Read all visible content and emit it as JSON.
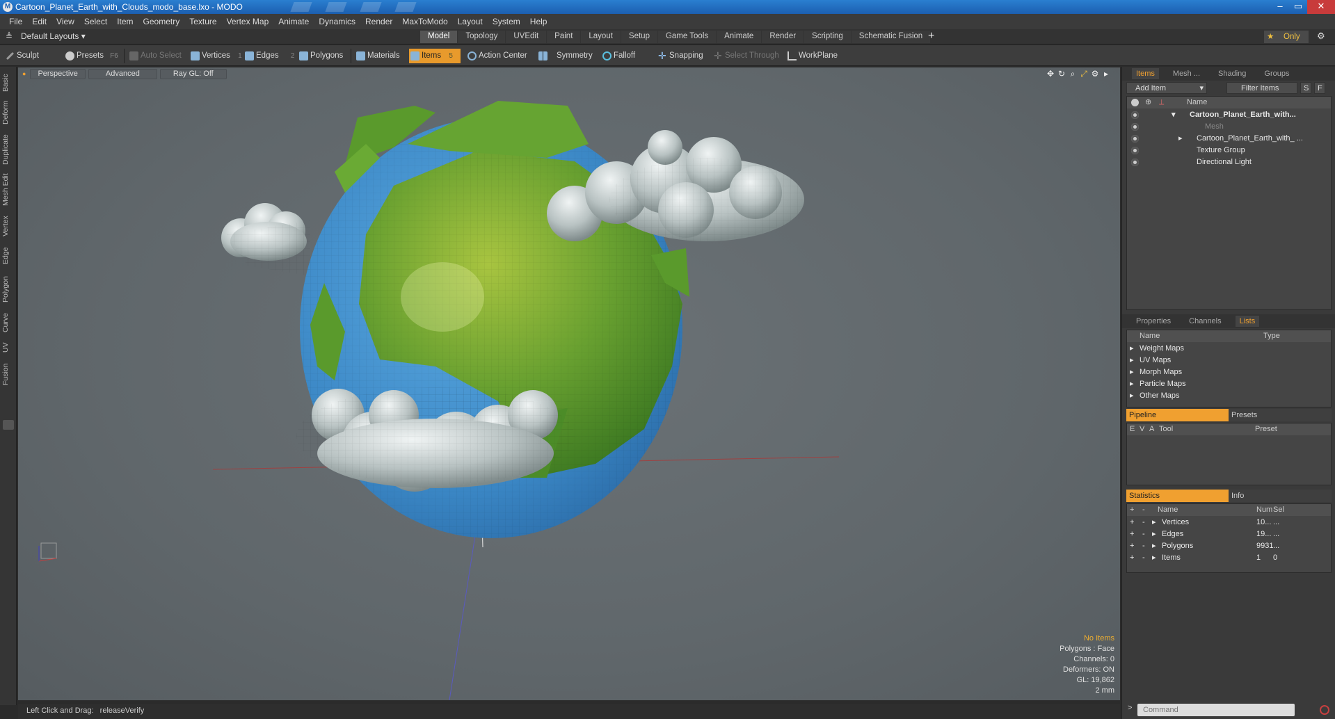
{
  "window": {
    "title": "Cartoon_Planet_Earth_with_Clouds_modo_base.lxo - MODO",
    "app_icon": "modo-logo-icon",
    "controls": [
      "–",
      "▭",
      "✕"
    ]
  },
  "menu": [
    "File",
    "Edit",
    "View",
    "Select",
    "Item",
    "Geometry",
    "Texture",
    "Vertex Map",
    "Animate",
    "Dynamics",
    "Render",
    "MaxToModo",
    "Layout",
    "System",
    "Help"
  ],
  "layoutbar": {
    "layout_select": "Default Layouts ▾",
    "tabs": [
      "Model",
      "Topology",
      "UVEdit",
      "Paint",
      "Layout",
      "Setup",
      "Game Tools",
      "Animate",
      "Render",
      "Scripting",
      "Schematic Fusion"
    ],
    "active_tab": "Model",
    "only_label": "Only"
  },
  "toolbar": {
    "sculpt": "Sculpt",
    "presets": "Presets",
    "presets_key": "F6",
    "auto_select": "Auto Select",
    "vertices": "Vertices",
    "vertices_count": "1",
    "edges": "Edges",
    "edges_count": "2",
    "polygons": "Polygons",
    "materials": "Materials",
    "items": "Items",
    "items_count": "5",
    "action_center": "Action Center",
    "symmetry": "Symmetry",
    "falloff": "Falloff",
    "snapping": "Snapping",
    "select_through": "Select Through",
    "workplane": "WorkPlane"
  },
  "left_tabs": [
    "Basic",
    "Deform",
    "Duplicate",
    "Mesh Edit",
    "Vertex",
    "Edge",
    "Polygon",
    "Curve",
    "UV",
    "Fusion"
  ],
  "viewport": {
    "view_mode": "Perspective",
    "shading": "Advanced",
    "raygl": "Ray GL: Off",
    "stats": {
      "no_items": "No Items",
      "polygons": "Polygons : Face",
      "channels": "Channels: 0",
      "deformers": "Deformers: ON",
      "gl": "GL: 19,862",
      "scale": "2 mm"
    }
  },
  "status": {
    "hint": "Left Click and Drag:",
    "action": "releaseVerify"
  },
  "items_panel": {
    "tabs": [
      "Items",
      "Mesh ...",
      "Shading",
      "Groups"
    ],
    "active_tab": "Items",
    "add_item": "Add Item",
    "filter_items": "Filter Items",
    "s_btn": "S",
    "f_btn": "F",
    "column_name": "Name",
    "tree": [
      {
        "label": "Cartoon_Planet_Earth_with...",
        "bold": true
      },
      {
        "label": "Mesh",
        "dim": true
      },
      {
        "label": "Cartoon_Planet_Earth_with_ ..."
      },
      {
        "label": "Texture Group"
      },
      {
        "label": "Directional Light"
      }
    ]
  },
  "props_panel": {
    "tabs": [
      "Properties",
      "Channels",
      "Lists"
    ],
    "active_tab": "Lists",
    "col_name": "Name",
    "col_type": "Type",
    "rows": [
      "Weight Maps",
      "UV Maps",
      "Morph Maps",
      "Particle Maps",
      "Other Maps"
    ]
  },
  "pipeline_panel": {
    "tabs": [
      "Pipeline",
      "Presets"
    ],
    "active_tab": "Pipeline",
    "cols": [
      "E",
      "V",
      "A",
      "Tool",
      "Preset"
    ]
  },
  "stats_panel": {
    "tabs": [
      "Statistics",
      "Info"
    ],
    "active_tab": "Statistics",
    "cols": [
      "Name",
      "Num",
      "Sel"
    ],
    "rows": [
      {
        "name": "Vertices",
        "num": "10...",
        "sel": "..."
      },
      {
        "name": "Edges",
        "num": "19...",
        "sel": "..."
      },
      {
        "name": "Polygons",
        "num": "9931",
        "sel": "..."
      },
      {
        "name": "Items",
        "num": "1",
        "sel": "0"
      }
    ]
  },
  "command": {
    "placeholder": "Command"
  },
  "colors": {
    "accent": "#f0a030",
    "ocean": "#3a86c4",
    "land": "#5a9a2c",
    "cloud": "#c8d0d0"
  }
}
